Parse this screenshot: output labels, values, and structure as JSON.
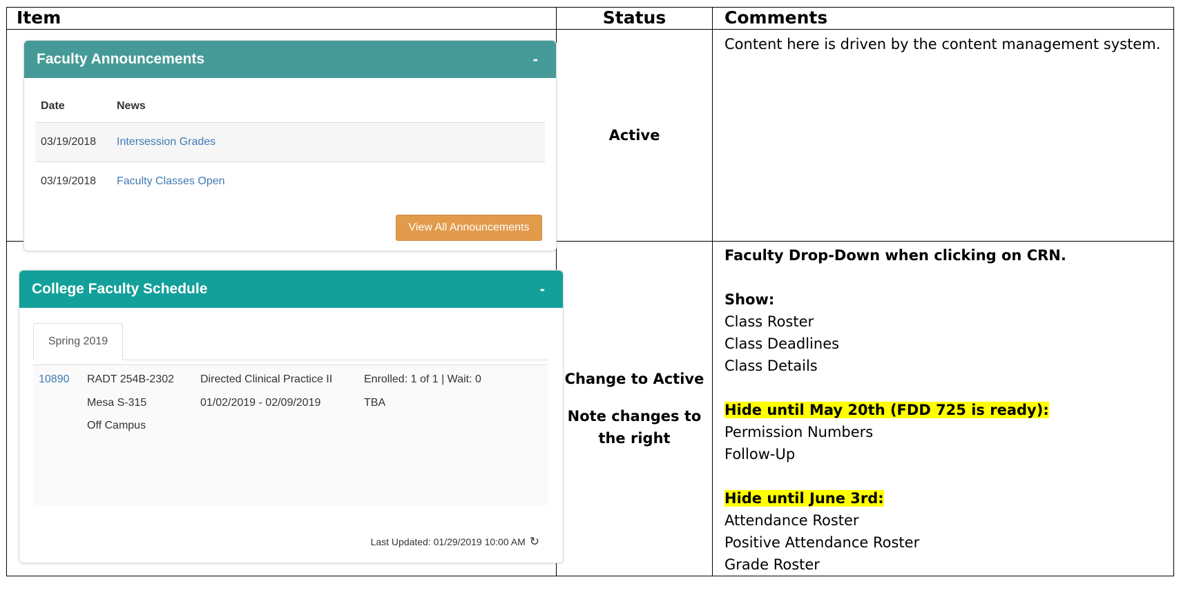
{
  "table": {
    "headers": {
      "item": "Item",
      "status": "Status",
      "comments": "Comments"
    }
  },
  "row1": {
    "status": "Active",
    "comment": "Content here is driven by the content management system."
  },
  "row2": {
    "status_line1": "Change to Active",
    "status_line2": "Note changes to the right",
    "comments": {
      "title": "Faculty Drop-Down when clicking on CRN.",
      "show_label": "Show:",
      "show_items": [
        "Class Roster",
        "Class Deadlines",
        "Class Details"
      ],
      "hide1_label": "Hide until May 20th (FDD 725 is ready):",
      "hide1_items": [
        "Permission Numbers",
        "Follow-Up"
      ],
      "hide2_label": "Hide until June 3rd:",
      "hide2_items": [
        "Attendance Roster",
        "Positive Attendance Roster",
        "Grade Roster"
      ]
    }
  },
  "announcements": {
    "title": "Faculty Announcements",
    "collapse": "-",
    "columns": [
      "Date",
      "News"
    ],
    "rows": [
      {
        "date": "03/19/2018",
        "news": "Intersession Grades"
      },
      {
        "date": "03/19/2018",
        "news": "Faculty Classes Open"
      }
    ],
    "button": "View All Announcements"
  },
  "schedule": {
    "title": "College Faculty Schedule",
    "collapse": "-",
    "tab": "Spring 2019",
    "crn": "10890",
    "course": "RADT 254B-2302",
    "location": "Mesa S-315",
    "campus": "Off Campus",
    "name": "Directed Clinical Practice II",
    "dates": "01/02/2019 - 02/09/2019",
    "enrolled": "Enrolled: 1 of 1 | Wait: 0",
    "time": "TBA",
    "last_updated": "Last Updated: 01/29/2019 10:00 AM"
  },
  "icons": {
    "refresh": "refresh-icon"
  },
  "colors": {
    "announcements_header": "#459a97",
    "schedule_header": "#14a09a",
    "button": "#e29a4b",
    "link": "#3f7ab5",
    "highlight": "#ffff00"
  }
}
